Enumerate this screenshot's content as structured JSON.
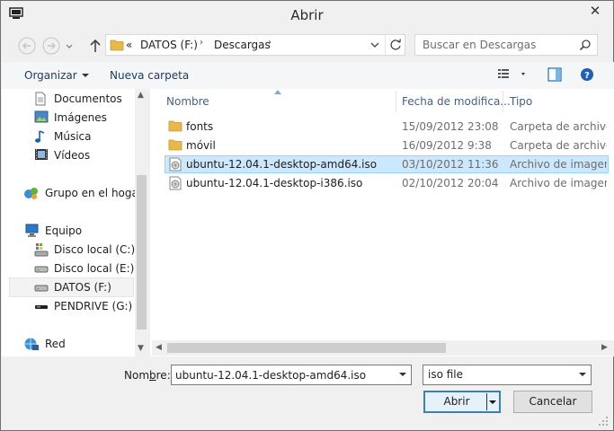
{
  "window": {
    "title": "Abrir",
    "close_glyph": "✕"
  },
  "address": {
    "root_chevron": "«",
    "crumbs": [
      "DATOS (F:)",
      "Descargas"
    ],
    "separator": "›"
  },
  "search": {
    "placeholder": "Buscar en Descargas"
  },
  "toolbar": {
    "organize": "Organizar",
    "new_folder": "Nueva carpeta"
  },
  "nav": {
    "items": [
      {
        "label": "Documentos",
        "icon": "documents-icon"
      },
      {
        "label": "Imágenes",
        "icon": "pictures-icon"
      },
      {
        "label": "Música",
        "icon": "music-icon"
      },
      {
        "label": "Vídeos",
        "icon": "videos-icon"
      },
      {
        "label": "Grupo en el hogar",
        "icon": "homegroup-icon"
      },
      {
        "label": "Equipo",
        "icon": "computer-icon"
      },
      {
        "label": "Disco local (C:)",
        "icon": "system-drive-icon"
      },
      {
        "label": "Disco local (E:)",
        "icon": "drive-icon"
      },
      {
        "label": "DATOS (F:)",
        "icon": "drive-icon",
        "selected": true
      },
      {
        "label": "PENDRIVE (G:)",
        "icon": "usb-drive-icon"
      },
      {
        "label": "Red",
        "icon": "network-icon"
      }
    ]
  },
  "files": {
    "columns": {
      "name": "Nombre",
      "date": "Fecha de modifica...",
      "type": "Tipo"
    },
    "rows": [
      {
        "name": "fonts",
        "date": "15/09/2012 23:08",
        "type": "Carpeta de archivos",
        "icon": "folder-icon"
      },
      {
        "name": "móvil",
        "date": "16/09/2012 9:38",
        "type": "Carpeta de archivos",
        "icon": "folder-icon"
      },
      {
        "name": "ubuntu-12.04.1-desktop-amd64.iso",
        "date": "03/10/2012 11:36",
        "type": "Archivo de imagen...",
        "icon": "disc-image-icon",
        "selected": true
      },
      {
        "name": "ubuntu-12.04.1-desktop-i386.iso",
        "date": "02/10/2012 20:04",
        "type": "Archivo de imagen...",
        "icon": "disc-image-icon"
      }
    ]
  },
  "bottom": {
    "name_label_prefix": "Nom",
    "name_label_accel": "b",
    "name_label_suffix": "re:",
    "filename": "ubuntu-12.04.1-desktop-amd64.iso",
    "filetype": "iso file",
    "open_label": "Abrir",
    "cancel_label": "Cancelar"
  },
  "colors": {
    "selection": "#cce8ff",
    "selection_border": "#99d1ff",
    "header_text": "#4c607a",
    "primary_border": "#3c7fb1"
  }
}
